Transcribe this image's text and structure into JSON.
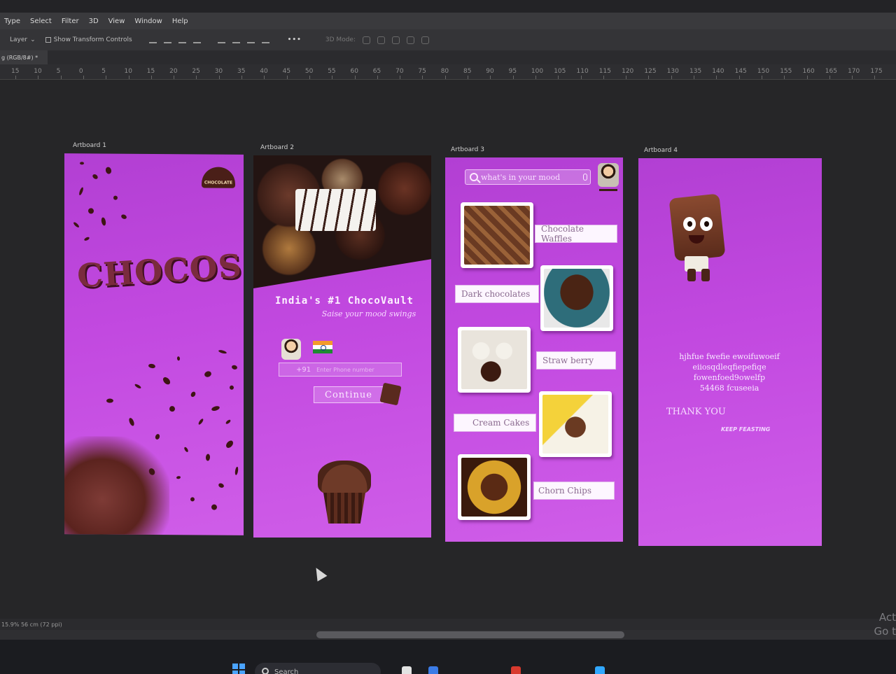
{
  "menu": [
    "Type",
    "Select",
    "Filter",
    "3D",
    "View",
    "Window",
    "Help"
  ],
  "options": {
    "layer_select": "Layer",
    "show_transform": "Show Transform Controls",
    "mode_label": "3D Mode:"
  },
  "tab": {
    "label": "g (RGB/8#) *"
  },
  "ruler_ticks": [
    "15",
    "10",
    "5",
    "0",
    "5",
    "10",
    "15",
    "20",
    "25",
    "30",
    "35",
    "40",
    "45",
    "50",
    "55",
    "60",
    "65",
    "70",
    "75",
    "80",
    "85",
    "90",
    "95",
    "100",
    "105",
    "110",
    "115",
    "120",
    "125",
    "130",
    "135",
    "140",
    "145",
    "150",
    "155",
    "160",
    "165",
    "170",
    "175"
  ],
  "artboards": {
    "ab1": {
      "label": "Artboard 1",
      "title": "CHOCOS",
      "logo_text": "CHOCOLATE"
    },
    "ab2": {
      "label": "Artboard 2",
      "heading": "India's #1 ChocoVault",
      "tagline": "Saise your mood swings",
      "phone_code": "+91",
      "phone_placeholder": "Enter Phone number",
      "continue_label": "Continue"
    },
    "ab3": {
      "label": "Artboard 3",
      "search_placeholder": "what's in your mood",
      "items": [
        {
          "label": "Chocolate Waffles"
        },
        {
          "label": "Dark chocolates"
        },
        {
          "label": "Straw berry"
        },
        {
          "label": "Cream Cakes"
        },
        {
          "label": "Chorn Chips"
        }
      ]
    },
    "ab4": {
      "label": "Artboard 4",
      "lorem_lines": [
        "hjhfue fwefie ewoifuwoeif",
        "eiiosqdleqfiepefiqe",
        "fowenfoed9owelfp",
        "54468 fcuseeia"
      ],
      "thanks": "THANK YOU",
      "keep": "KEEP FEASTING"
    }
  },
  "status": {
    "zoom": "15.9% 56 cm (72 ppi)"
  },
  "taskbar": {
    "search_label": "Search"
  },
  "activate": {
    "line1": "Act",
    "line2": "Go t"
  },
  "colors": {
    "artboard_purple": "#c249e0",
    "chrome_dark": "#3a3a3d",
    "chocolate": "#5a2b1b"
  }
}
